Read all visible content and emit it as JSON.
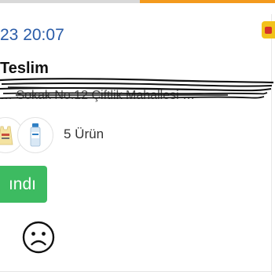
{
  "order": {
    "date": "23 20:07",
    "status": "Teslim",
    "address": "… Sokak No:12 Çiftlik Mahallesi …",
    "product_count_label": "5 Ürün",
    "action_label": "ındı"
  },
  "products": [
    {
      "icon": "top-garment-icon"
    },
    {
      "icon": "bottle-icon"
    }
  ],
  "rating": {
    "icon": "sad-face-icon"
  },
  "colors": {
    "accent_orange": "#f39a1d",
    "date_blue": "#2a5ca8",
    "button_green": "#3dbb61",
    "badge_yellow": "#f2c21b"
  }
}
